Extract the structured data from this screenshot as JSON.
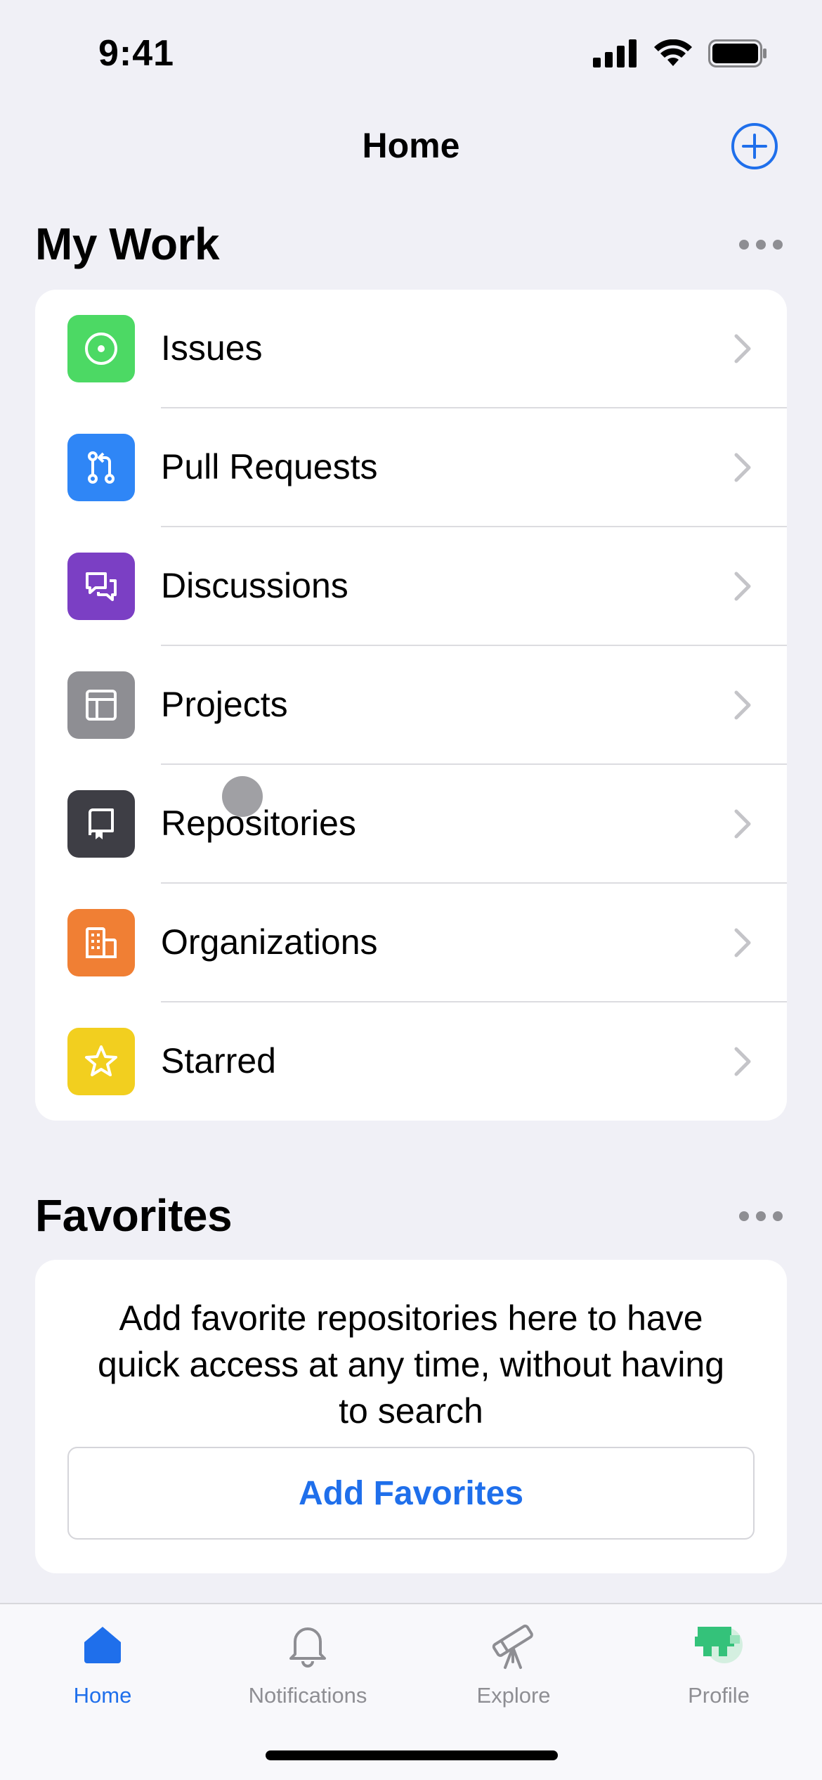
{
  "status_bar": {
    "time": "9:41"
  },
  "header": {
    "title": "Home"
  },
  "my_work": {
    "title": "My Work",
    "items": [
      {
        "label": "Issues",
        "icon": "issue-opened-icon",
        "color": "#4cd964"
      },
      {
        "label": "Pull Requests",
        "icon": "pull-request-icon",
        "color": "#2f86f6"
      },
      {
        "label": "Discussions",
        "icon": "discussions-icon",
        "color": "#7b3fc4"
      },
      {
        "label": "Projects",
        "icon": "projects-icon",
        "color": "#8e8e93"
      },
      {
        "label": "Repositories",
        "icon": "repository-icon",
        "color": "#3e3e45"
      },
      {
        "label": "Organizations",
        "icon": "organization-icon",
        "color": "#f07f34"
      },
      {
        "label": "Starred",
        "icon": "star-icon",
        "color": "#f2cf1f"
      }
    ]
  },
  "favorites": {
    "title": "Favorites",
    "description": "Add favorite repositories here to have quick access at any time, without having to search",
    "button_label": "Add Favorites"
  },
  "tab_bar": {
    "tabs": [
      {
        "label": "Home",
        "icon": "home-icon",
        "active": true
      },
      {
        "label": "Notifications",
        "icon": "bell-icon",
        "active": false
      },
      {
        "label": "Explore",
        "icon": "telescope-icon",
        "active": false
      },
      {
        "label": "Profile",
        "icon": "avatar",
        "active": false
      }
    ]
  },
  "colors": {
    "accent": "#1f6feb",
    "background": "#f0f0f6",
    "inactive": "#8e8e93"
  }
}
